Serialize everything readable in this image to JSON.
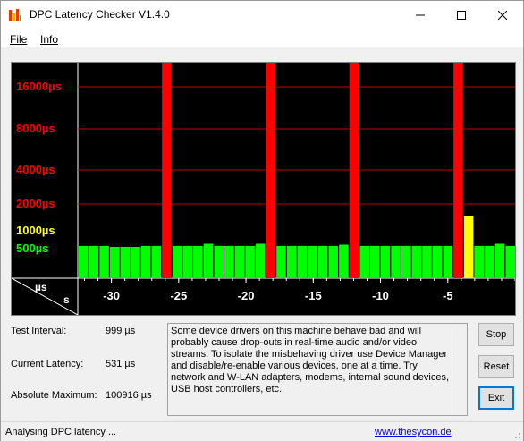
{
  "window": {
    "title": "DPC Latency Checker V1.4.0"
  },
  "menu": {
    "file_label": "File",
    "info_label": "Info"
  },
  "chart_data": {
    "type": "bar",
    "title": "",
    "y_tick_labels": [
      "16000µs",
      "8000µs",
      "4000µs",
      "2000µs",
      "1000µs",
      "500µs"
    ],
    "y_tick_values": [
      16000,
      8000,
      4000,
      2000,
      1000,
      500
    ],
    "y_tick_colors": [
      "#ff0000",
      "#ff0000",
      "#ff0000",
      "#ff0000",
      "#ffff00",
      "#00ff00"
    ],
    "y_scale": "log",
    "unit_top": "µs",
    "unit_bottom": "s",
    "x_tick_values": [
      -30,
      -25,
      -20,
      -15,
      -10,
      -5
    ],
    "x_tick_labels": [
      "-30",
      "-25",
      "-20",
      "-15",
      "-10",
      "-5"
    ],
    "x_range": [
      -32.5,
      0
    ],
    "grid": true,
    "bar_count": 31,
    "values": [
      531,
      531,
      531,
      520,
      520,
      520,
      531,
      531,
      100916,
      531,
      531,
      531,
      555,
      531,
      531,
      531,
      531,
      555,
      100916,
      531,
      531,
      531,
      531,
      531,
      531,
      545,
      100916,
      531,
      531,
      531,
      531,
      531,
      531,
      531,
      531,
      531,
      100916,
      999,
      531,
      531,
      555,
      531
    ],
    "colors": {
      "ok": "#00ff00",
      "warn": "#ffff00",
      "bad": "#ff0000",
      "grid": "#c00000",
      "axis": "#ffffff"
    }
  },
  "stats": {
    "test_interval_label": "Test Interval:",
    "test_interval_value": "999 µs",
    "current_latency_label": "Current Latency:",
    "current_latency_value": "531 µs",
    "absolute_max_label": "Absolute Maximum:",
    "absolute_max_value": "100916 µs"
  },
  "info_text": "Some device drivers on this machine behave bad and will probably cause drop-outs in real-time audio and/or video streams. To isolate the misbehaving driver use Device Manager and disable/re-enable various devices, one at a time. Try network and W-LAN adapters, modems, internal sound devices, USB host controllers, etc.",
  "buttons": {
    "stop": "Stop",
    "reset": "Reset",
    "exit": "Exit"
  },
  "status": {
    "text": "Analysing DPC latency ...",
    "link": "www.thesycon.de"
  }
}
